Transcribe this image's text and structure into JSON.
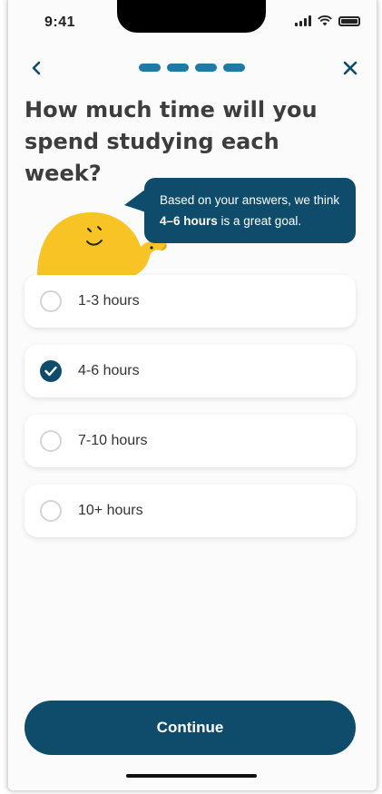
{
  "status_bar": {
    "time": "9:41"
  },
  "nav": {
    "progress_steps": 4
  },
  "question": {
    "title": "How much time will you spend studying each week?"
  },
  "hint": {
    "prefix": "Based on your answers, we think ",
    "highlight": "4–6 hours",
    "suffix": " is a great goal."
  },
  "options": [
    {
      "label": "1-3 hours",
      "selected": false
    },
    {
      "label": "4-6 hours",
      "selected": true
    },
    {
      "label": "7-10 hours",
      "selected": false
    },
    {
      "label": "10+ hours",
      "selected": false
    }
  ],
  "continue_label": "Continue",
  "colors": {
    "primary": "#0f4c6b",
    "progress": "#1d7ba6",
    "mascot": "#f7c325",
    "background": "#fbfbfb"
  }
}
